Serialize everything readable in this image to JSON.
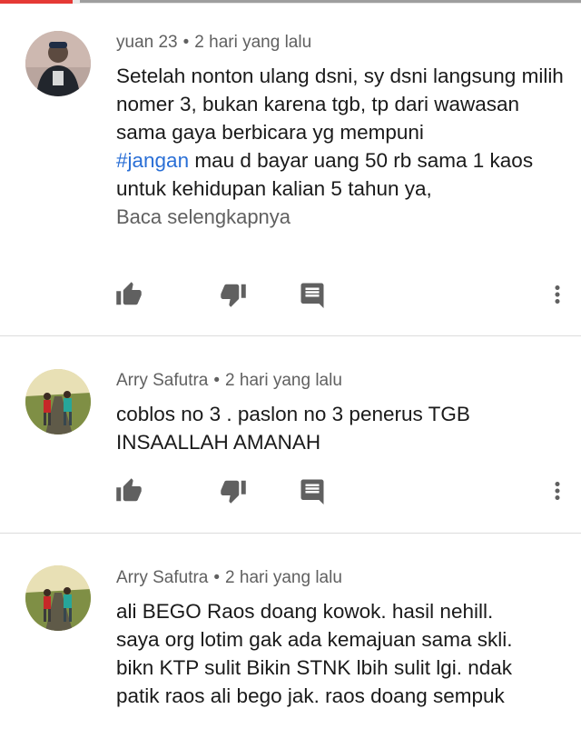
{
  "comments": [
    {
      "author": "yuan 23",
      "separator": "•",
      "time": "2 hari yang lalu",
      "text_before": "Setelah nonton ulang dsni, sy dsni langsung milih nomer 3, bukan karena tgb, tp dari wawasan sama gaya berbicara yg mempuni\n",
      "hashtag": "#jangan",
      "text_after": " mau d bayar uang 50 rb sama 1 kaos untuk kehidupan kalian 5 tahun ya,",
      "read_more": "Baca selengkapnya"
    },
    {
      "author": "Arry Safutra",
      "separator": "•",
      "time": "2 hari yang lalu",
      "text": "coblos no 3 . paslon no 3 penerus TGB\nINSAALLAH AMANAH"
    },
    {
      "author": "Arry Safutra",
      "separator": "•",
      "time": "2 hari yang lalu",
      "text": "ali BEGO Raos doang kowok. hasil nehill.\nsaya org lotim gak ada kemajuan sama skli.\nbikn KTP sulit Bikin STNK lbih sulit lgi. ndak\npatik raos ali bego jak. raos doang sempuk"
    }
  ],
  "icons": {
    "like": "thumbs-up-icon",
    "dislike": "thumbs-down-icon",
    "reply": "reply-icon",
    "menu": "more-vert-icon"
  },
  "colors": {
    "hashtag": "#2a6fd6",
    "accent_bar": "#e53935",
    "icon": "#606060"
  }
}
